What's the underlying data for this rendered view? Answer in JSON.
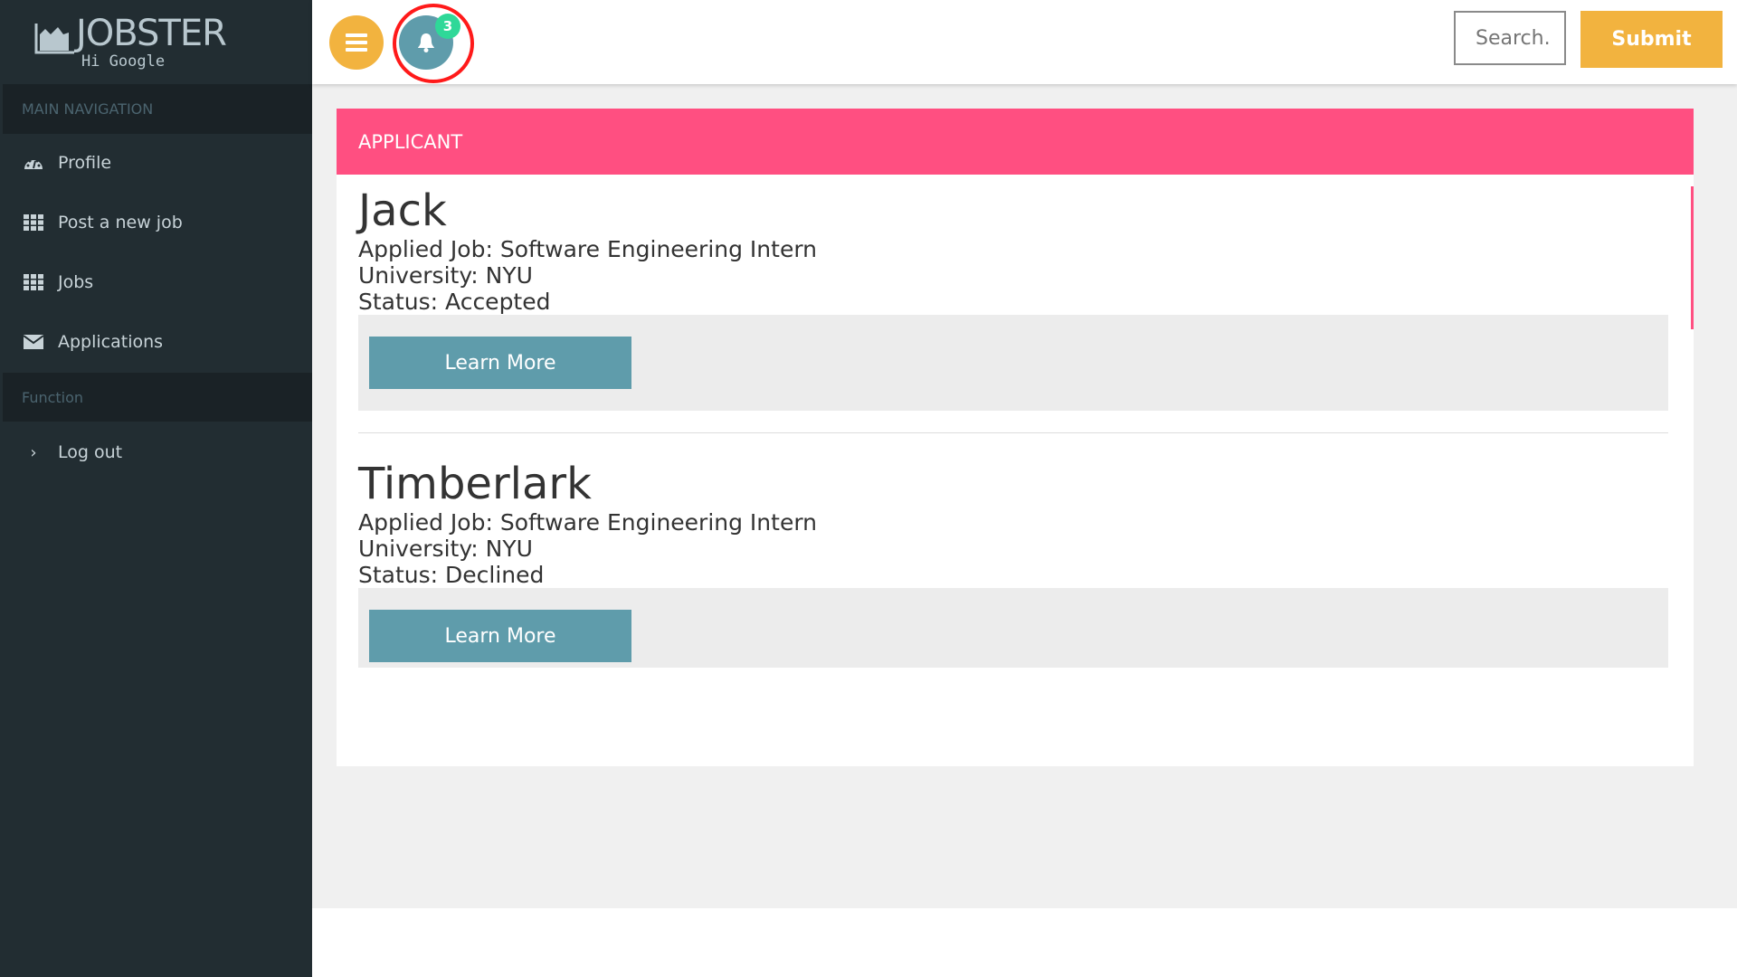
{
  "brand": {
    "name": "JOBSTER",
    "greeting": "Hi Google"
  },
  "sidebar": {
    "main_header": "MAIN NAVIGATION",
    "items": [
      {
        "label": "Profile",
        "icon": "dashboard-icon"
      },
      {
        "label": "Post a new job",
        "icon": "grid-icon"
      },
      {
        "label": "Jobs",
        "icon": "grid-icon"
      },
      {
        "label": "Applications",
        "icon": "envelope-icon"
      }
    ],
    "function_header": "Function",
    "logout": {
      "label": "Log out",
      "icon": "chevron-right-icon"
    }
  },
  "topbar": {
    "notification_count": "3",
    "search_placeholder": "Search.",
    "submit_label": "Submit"
  },
  "card": {
    "title": "APPLICANT",
    "applicants": [
      {
        "name": "Jack",
        "job": "Applied Job: Software Engineering Intern",
        "university": "University: NYU",
        "status": "Status: Accepted",
        "button": "Learn More"
      },
      {
        "name": "Timberlark",
        "job": "Applied Job: Software Engineering Intern",
        "university": "University: NYU",
        "status": "Status: Declined",
        "button": "Learn More"
      }
    ]
  },
  "colors": {
    "sidebar": "#222d32",
    "accent_pink": "#ff4f81",
    "accent_yellow": "#f2b33f",
    "button_teal": "#5f9cab",
    "badge_green": "#2fd898"
  }
}
